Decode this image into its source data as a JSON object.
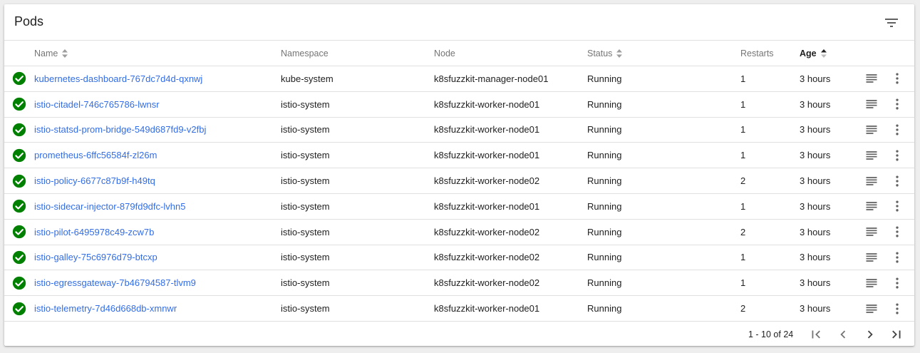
{
  "header": {
    "title": "Pods"
  },
  "columns": {
    "name": "Name",
    "namespace": "Namespace",
    "node": "Node",
    "status": "Status",
    "restarts": "Restarts",
    "age": "Age"
  },
  "rows": [
    {
      "name": "kubernetes-dashboard-767dc7d4d-qxnwj",
      "namespace": "kube-system",
      "node": "k8sfuzzkit-manager-node01",
      "status": "Running",
      "restarts": "1",
      "age": "3 hours"
    },
    {
      "name": "istio-citadel-746c765786-lwnsr",
      "namespace": "istio-system",
      "node": "k8sfuzzkit-worker-node01",
      "status": "Running",
      "restarts": "1",
      "age": "3 hours"
    },
    {
      "name": "istio-statsd-prom-bridge-549d687fd9-v2fbj",
      "namespace": "istio-system",
      "node": "k8sfuzzkit-worker-node01",
      "status": "Running",
      "restarts": "1",
      "age": "3 hours"
    },
    {
      "name": "prometheus-6ffc56584f-zl26m",
      "namespace": "istio-system",
      "node": "k8sfuzzkit-worker-node01",
      "status": "Running",
      "restarts": "1",
      "age": "3 hours"
    },
    {
      "name": "istio-policy-6677c87b9f-h49tq",
      "namespace": "istio-system",
      "node": "k8sfuzzkit-worker-node02",
      "status": "Running",
      "restarts": "2",
      "age": "3 hours"
    },
    {
      "name": "istio-sidecar-injector-879fd9dfc-lvhn5",
      "namespace": "istio-system",
      "node": "k8sfuzzkit-worker-node01",
      "status": "Running",
      "restarts": "1",
      "age": "3 hours"
    },
    {
      "name": "istio-pilot-6495978c49-zcw7b",
      "namespace": "istio-system",
      "node": "k8sfuzzkit-worker-node02",
      "status": "Running",
      "restarts": "2",
      "age": "3 hours"
    },
    {
      "name": "istio-galley-75c6976d79-btcxp",
      "namespace": "istio-system",
      "node": "k8sfuzzkit-worker-node02",
      "status": "Running",
      "restarts": "1",
      "age": "3 hours"
    },
    {
      "name": "istio-egressgateway-7b46794587-tlvm9",
      "namespace": "istio-system",
      "node": "k8sfuzzkit-worker-node02",
      "status": "Running",
      "restarts": "1",
      "age": "3 hours"
    },
    {
      "name": "istio-telemetry-7d46d668db-xmnwr",
      "namespace": "istio-system",
      "node": "k8sfuzzkit-worker-node01",
      "status": "Running",
      "restarts": "2",
      "age": "3 hours"
    }
  ],
  "pagination": {
    "range": "1 - 10 of 24"
  },
  "icons": {
    "status": "check-circle-icon",
    "logs": "logs-icon",
    "menu": "more-vert-icon",
    "filter": "filter-icon"
  },
  "colors": {
    "link": "#326de6",
    "success": "#008000"
  }
}
